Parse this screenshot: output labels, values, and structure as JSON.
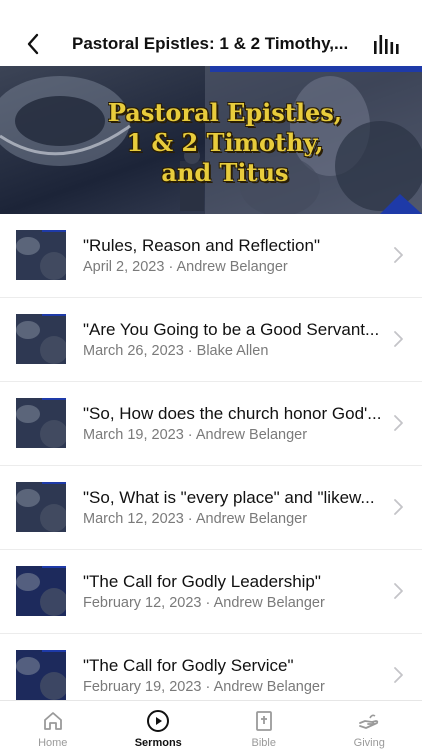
{
  "status": {
    "text": ""
  },
  "header": {
    "title": "Pastoral Epistles: 1 & 2 Timothy,..."
  },
  "banner": {
    "line1": "Pastoral Epistles,",
    "line2": "1 & 2 Timothy,",
    "line3": "and Titus"
  },
  "sermons": [
    {
      "title": "\"Rules, Reason and Reflection\"",
      "date": "April 2, 2023",
      "speaker": "Andrew Belanger",
      "meta": "April 2, 2023 · Andrew Belanger",
      "thumb": "pastoral"
    },
    {
      "title": "\"Are You Going to be a Good Servant...",
      "date": "March 26, 2023",
      "speaker": "Blake Allen",
      "meta": "March 26, 2023 · Blake Allen",
      "thumb": "pastoral"
    },
    {
      "title": "\"So, How does the church honor God'...",
      "date": "March 19, 2023",
      "speaker": "Andrew Belanger",
      "meta": "March 19, 2023 · Andrew Belanger",
      "thumb": "pastoral"
    },
    {
      "title": "\"So, What is \"every place\" and \"likew...",
      "date": "March 12, 2023",
      "speaker": "Andrew Belanger",
      "meta": "March 12, 2023 · Andrew Belanger",
      "thumb": "pastoral"
    },
    {
      "title": "\"The Call for Godly Leadership\"",
      "date": "February 12, 2023",
      "speaker": "Andrew Belanger",
      "meta": "February 12, 2023 · Andrew Belanger",
      "thumb": "timothy"
    },
    {
      "title": "\"The Call for Godly Service\"",
      "date": "February 19, 2023",
      "speaker": "Andrew Belanger",
      "meta": "February 19, 2023 · Andrew Belanger",
      "thumb": "timothy"
    }
  ],
  "tabs": [
    {
      "label": "Home",
      "icon": "home-icon",
      "active": false
    },
    {
      "label": "Sermons",
      "icon": "play-circle-icon",
      "active": true
    },
    {
      "label": "Bible",
      "icon": "bible-icon",
      "active": false
    },
    {
      "label": "Giving",
      "icon": "giving-hand-icon",
      "active": false
    }
  ],
  "colors": {
    "accent_gold": "#e8cc3c",
    "text_primary": "#111111",
    "text_secondary": "#7a7a7a",
    "tab_inactive": "#9a9a9a"
  }
}
